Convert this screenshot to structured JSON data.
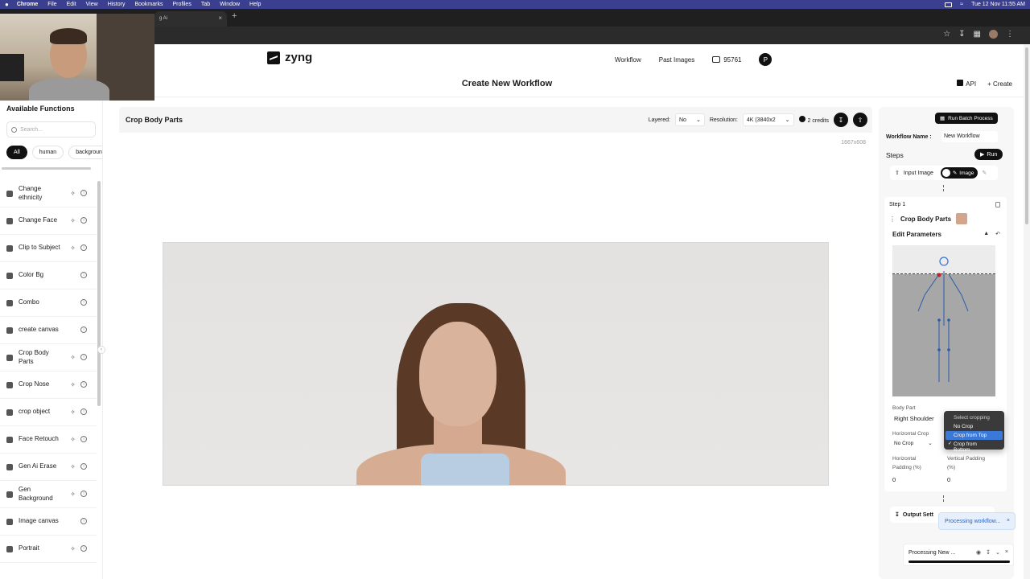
{
  "menubar": {
    "app": "Chrome",
    "items": [
      "File",
      "Edit",
      "View",
      "History",
      "Bookmarks",
      "Profiles",
      "Tab",
      "Window",
      "Help"
    ],
    "clock": "Tue 12 Nov  11:55 AM"
  },
  "browser": {
    "tab_title": "g Ai"
  },
  "header": {
    "logo": "zyng",
    "nav": {
      "workflow": "Workflow",
      "past_images": "Past Images",
      "credits": "95761",
      "profile_initial": "P"
    }
  },
  "title_bar": {
    "title": "Create New Workflow",
    "api": "API",
    "create": "Create"
  },
  "sidebar": {
    "heading": "Available Functions",
    "search_placeholder": "Search...",
    "filters": [
      "All",
      "human",
      "background"
    ],
    "functions": [
      {
        "name": "Change ethnicity",
        "ai": true
      },
      {
        "name": "Change Face",
        "ai": true
      },
      {
        "name": "Clip to Subject",
        "ai": true
      },
      {
        "name": "Color Bg",
        "ai": false
      },
      {
        "name": "Combo",
        "ai": false
      },
      {
        "name": "create canvas",
        "ai": false
      },
      {
        "name": "Crop Body Parts",
        "ai": true
      },
      {
        "name": "Crop Nose",
        "ai": true
      },
      {
        "name": "crop object",
        "ai": true
      },
      {
        "name": "Face Retouch",
        "ai": true
      },
      {
        "name": "Gen Ai Erase",
        "ai": true
      },
      {
        "name": "Gen Background",
        "ai": true
      },
      {
        "name": "Image canvas",
        "ai": false
      },
      {
        "name": "Portrait",
        "ai": true
      }
    ]
  },
  "center": {
    "title": "Crop Body Parts",
    "layered_label": "Layered:",
    "layered_value": "No",
    "resolution_label": "Resolution:",
    "resolution_value": "4K (3840x2",
    "credits": "2 credits",
    "dimensions": "1667x608"
  },
  "right_panel": {
    "batch_button": "Run Batch Process",
    "workflow_name_label": "Workflow Name :",
    "workflow_name_value": "New Workflow",
    "steps_label": "Steps",
    "run_button": "Run",
    "input_image_label": "Input Image",
    "image_toggle": "Image",
    "step_number": "Step 1",
    "step_name": "Crop Body Parts",
    "edit_parameters": "Edit Parameters",
    "body_part_label": "Body Part",
    "body_part_value": "Right Shoulder",
    "horizontal_crop_label": "Horizontal Crop",
    "horizontal_crop_value": "No Crop",
    "horizontal_padding_label_1": "Horizontal",
    "horizontal_padding_label_2": "Padding (%)",
    "horizontal_padding_value": "0",
    "vertical_padding_label_1": "Vertical Padding",
    "vertical_padding_label_2": "(%)",
    "vertical_padding_value": "0",
    "output_settings": "Output Sett"
  },
  "dropdown": {
    "options": [
      "Select cropping",
      "No Crop",
      "Crop from Top",
      "Crop from Bottom"
    ],
    "highlighted": "Crop from Top",
    "checked": "Crop from Bottom"
  },
  "toast": {
    "message": "Processing workflow..."
  },
  "processing": {
    "title": "Processing New ..."
  }
}
